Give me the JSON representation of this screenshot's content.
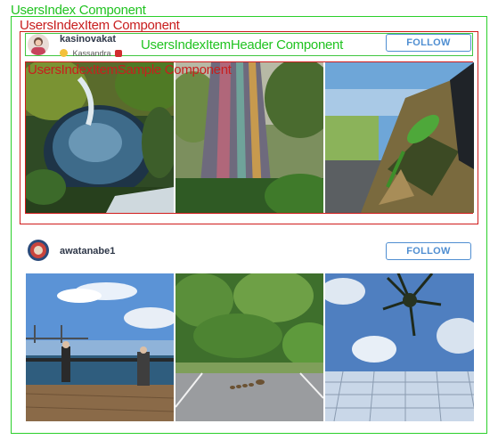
{
  "labels": {
    "users_index": "UsersIndex Component",
    "users_index_item": "UsersIndexItem Component",
    "users_index_item_header": "UsersIndexItemHeader Component",
    "users_index_item_sample": "UsersIndexItemSample Component"
  },
  "users": [
    {
      "username": "kasinovakat",
      "subname": "Kassandra",
      "follow_label": "FOLLOW",
      "photos": [
        "waterfall-pool",
        "rainbow-eucalyptus",
        "lizard-on-camo-jacket"
      ]
    },
    {
      "username": "awatanabe1",
      "follow_label": "FOLLOW",
      "photos": [
        "bay-bridge-pier",
        "ducklings-ivy-wall",
        "palm-tree-glass-roof"
      ]
    }
  ],
  "colors": {
    "accent": "#4f8ed1",
    "outline_green": "#2bd02b",
    "outline_red": "#d01b1b"
  }
}
